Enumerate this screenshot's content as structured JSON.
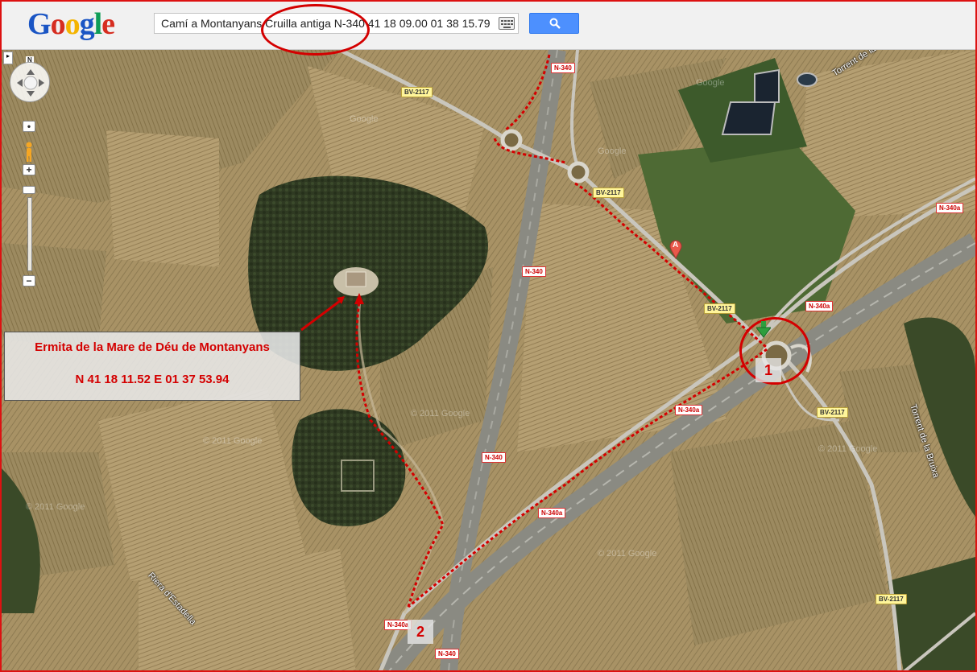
{
  "header": {
    "logo_letters": [
      {
        "char": "G",
        "color": "#1a55c4"
      },
      {
        "char": "o",
        "color": "#d62d20"
      },
      {
        "char": "o",
        "color": "#f4b400"
      },
      {
        "char": "g",
        "color": "#1a55c4"
      },
      {
        "char": "l",
        "color": "#0f9d58"
      },
      {
        "char": "e",
        "color": "#d62d20"
      }
    ],
    "search_query": "Camí a Montanyans  Cruilla antiga N-340 41 18 09.00 01 38 15.79",
    "keyboard_icon": "keyboard-icon",
    "search_icon": "search-icon"
  },
  "map_controls": {
    "north": "N",
    "zoom_in": "+",
    "zoom_out": "−"
  },
  "annotation": {
    "title": "Ermita de la Mare de Déu de Montanyans",
    "coords": "N 41  18  11.52  E 01  37  53.94"
  },
  "markers": {
    "a_label": "A",
    "point_1": "1",
    "point_2": "2"
  },
  "road_labels": {
    "bv2117": "BV-2117",
    "n340": "N-340",
    "n340a": "N-340a"
  },
  "place_labels": {
    "torrent_la": "Torrent de la",
    "torrent_bruixa": "Torrent de la Bruixa",
    "riera": "Riera d'Estadella"
  },
  "watermarks": {
    "google": "Google",
    "copyright": "© 2011 Google"
  },
  "colors": {
    "route": "#d40000",
    "highlight": "#d40000"
  }
}
